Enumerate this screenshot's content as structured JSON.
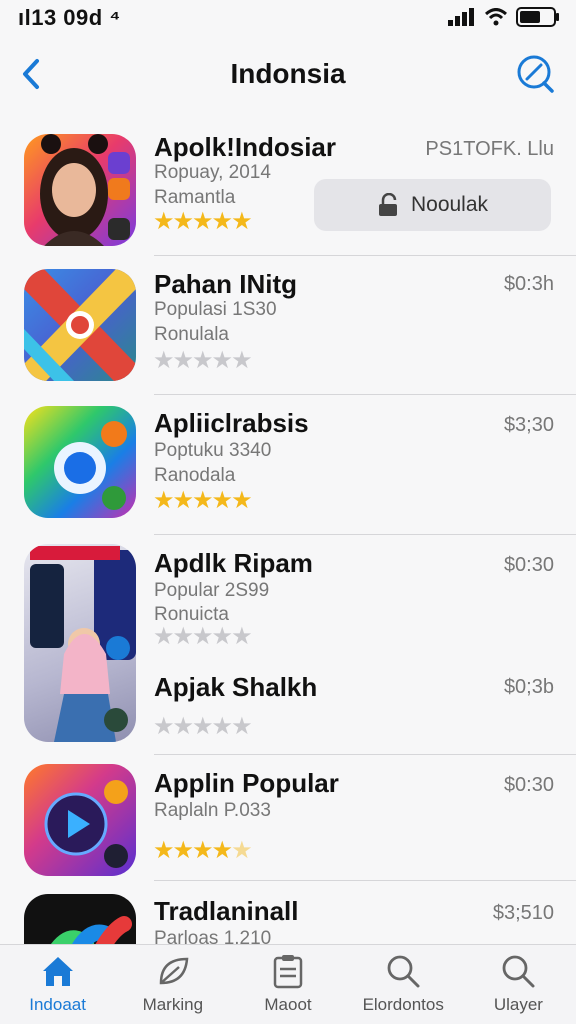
{
  "status": {
    "time": "ıl13 09d ⁴"
  },
  "nav": {
    "title": "Indonsia"
  },
  "apps": [
    {
      "title": "Apolk!Indosiar",
      "line1": "Ropuay, 2014",
      "line2": "Ramantla",
      "price": "PS1TOFK. Llu",
      "rating": 5,
      "button": "Nooulak"
    },
    {
      "title": "Pahan INitg",
      "line1": "Populasi 1S30",
      "line2": "Ronulala",
      "price": "$0:3h",
      "rating": 0
    },
    {
      "title": "Apliiclrabsis",
      "line1": "Poptuku 3340",
      "line2": "Ranodala",
      "price": "$3;30",
      "rating": 5
    },
    {
      "title": "Apdlk Ripam",
      "line1": "Popular 2S99",
      "line2": "Ronuicta",
      "price": "$0:30",
      "rating": 0
    },
    {
      "title": "Apjak Shalkh",
      "line1": "",
      "line2": "",
      "price": "$0;3b",
      "rating": 0
    },
    {
      "title": "Applin Popular",
      "line1": "Raplaln P.033",
      "line2": "",
      "price": "$0:30",
      "rating": 4.5
    },
    {
      "title": "Tradlaninall",
      "line1": "Parloas 1.210",
      "line2": "",
      "price": "$3;510",
      "rating": 0
    }
  ],
  "tabs": [
    {
      "label": "Indoaat",
      "icon": "home-icon"
    },
    {
      "label": "Marking",
      "icon": "leaf-icon"
    },
    {
      "label": "Maoot",
      "icon": "clipboard-icon"
    },
    {
      "label": "Elordontos",
      "icon": "search-icon"
    },
    {
      "label": "Ulayer",
      "icon": "search-icon"
    }
  ],
  "colors": {
    "accent": "#1a7ad6",
    "star": "#f4b81a"
  }
}
